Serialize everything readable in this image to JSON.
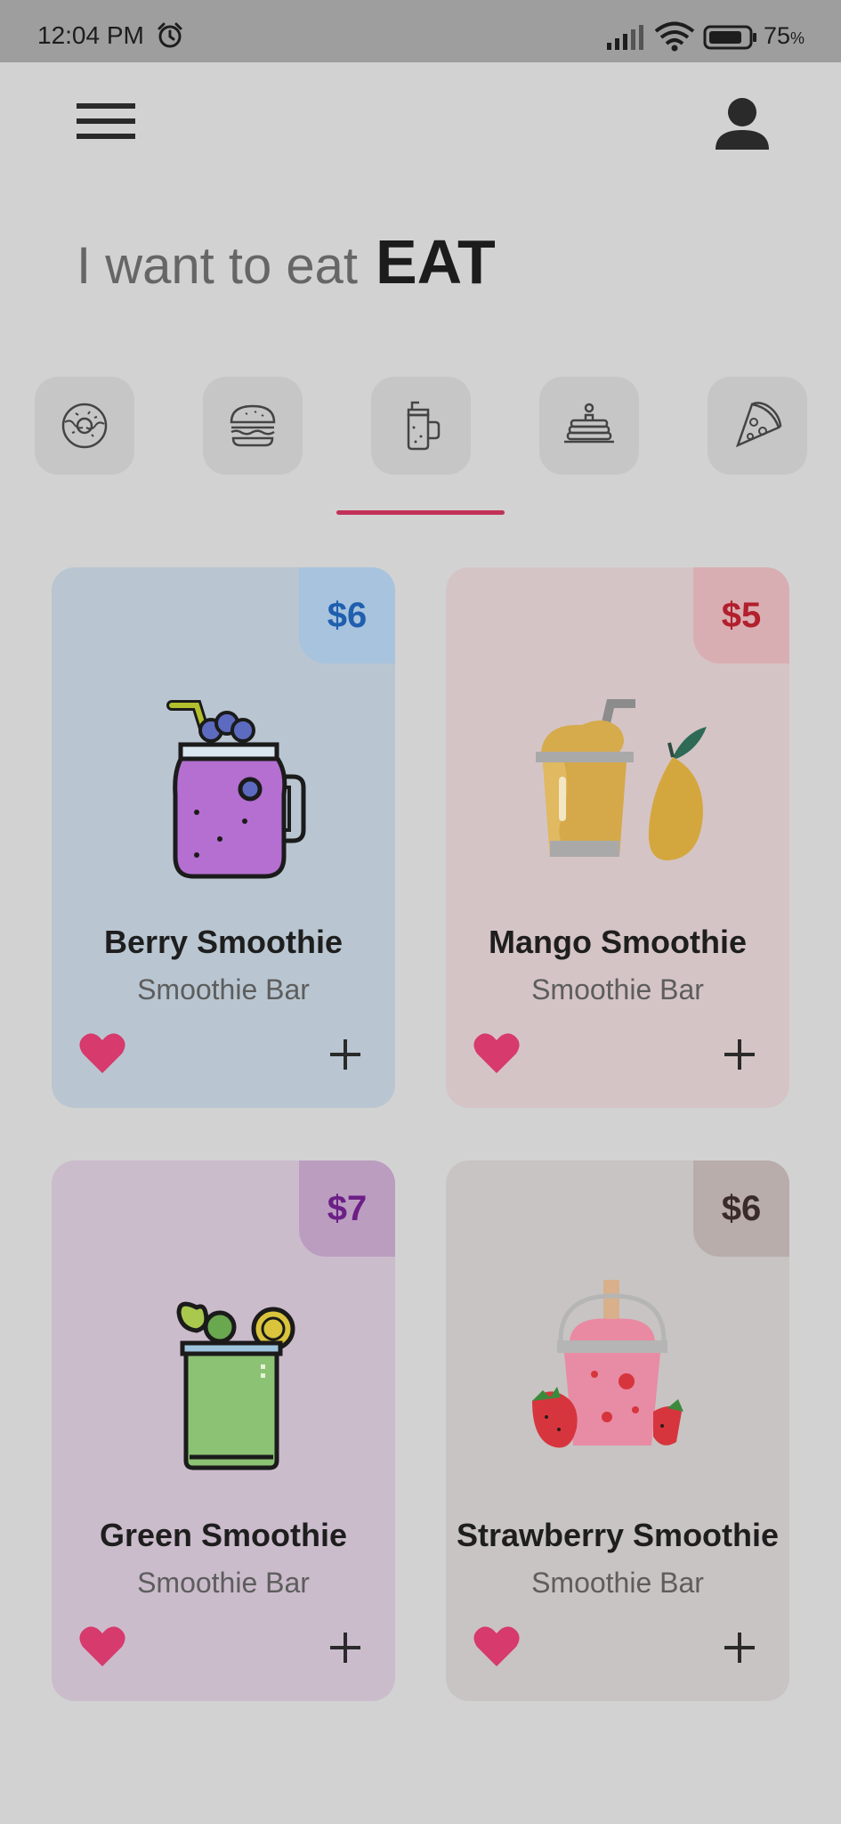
{
  "status_bar": {
    "time": "12:04 PM",
    "battery_percent": "75",
    "battery_unit": "%"
  },
  "header": {
    "menu_icon": "hamburger-menu-icon",
    "profile_icon": "user-icon"
  },
  "headline": {
    "prefix": "I want to eat",
    "emphasis": "EAT"
  },
  "categories": [
    {
      "icon": "donut-icon",
      "selected": false
    },
    {
      "icon": "burger-icon",
      "selected": false
    },
    {
      "icon": "smoothie-jar-icon",
      "selected": true
    },
    {
      "icon": "pancakes-icon",
      "selected": false
    },
    {
      "icon": "pizza-icon",
      "selected": false
    }
  ],
  "products": [
    {
      "name": "Berry Smoothie",
      "shop": "Smoothie Bar",
      "price": "$6",
      "bg": "#b9c6d1",
      "price_bg": "#a8c3de",
      "price_color": "#1f5fae"
    },
    {
      "name": "Mango Smoothie",
      "shop": "Smoothie Bar",
      "price": "$5",
      "bg": "#d5c4c6",
      "price_bg": "#d9aeb2",
      "price_color": "#b21f2d"
    },
    {
      "name": "Green Smoothie",
      "shop": "Smoothie Bar",
      "price": "$7",
      "bg": "#cbbccc",
      "price_bg": "#bb9dc0",
      "price_color": "#6c1f86"
    },
    {
      "name": "Strawberry Smoothie",
      "shop": "Smoothie Bar",
      "price": "$6",
      "bg": "#c8c4c3",
      "price_bg": "#b8adab",
      "price_color": "#3a2b2a"
    }
  ],
  "colors": {
    "heart": "#d73a6c",
    "accent": "#c23157"
  }
}
